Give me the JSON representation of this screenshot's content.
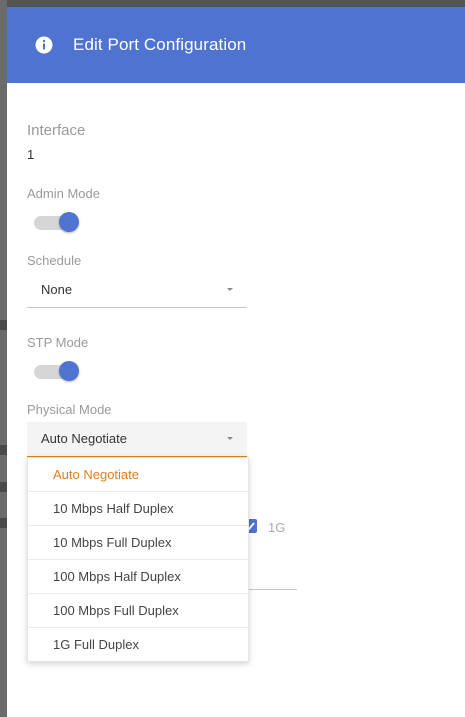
{
  "dialog": {
    "title": "Edit Port Configuration",
    "header_icon": "info-icon",
    "accent_color": "#4f74cf"
  },
  "fields": {
    "interface": {
      "label": "Interface",
      "value": "1"
    },
    "admin_mode": {
      "label": "Admin Mode",
      "enabled": true
    },
    "schedule": {
      "label": "Schedule",
      "value": "None"
    },
    "stp_mode": {
      "label": "STP Mode",
      "enabled": true
    },
    "physical_mode": {
      "label": "Physical Mode",
      "value": "Auto Negotiate",
      "options": [
        "Auto Negotiate",
        "10 Mbps Half Duplex",
        "10 Mbps Full Duplex",
        "100 Mbps Half Duplex",
        "100 Mbps Full Duplex",
        "1G Full Duplex"
      ],
      "selected_color": "#e07f1a"
    }
  },
  "behind": {
    "speed_label": "1G"
  }
}
